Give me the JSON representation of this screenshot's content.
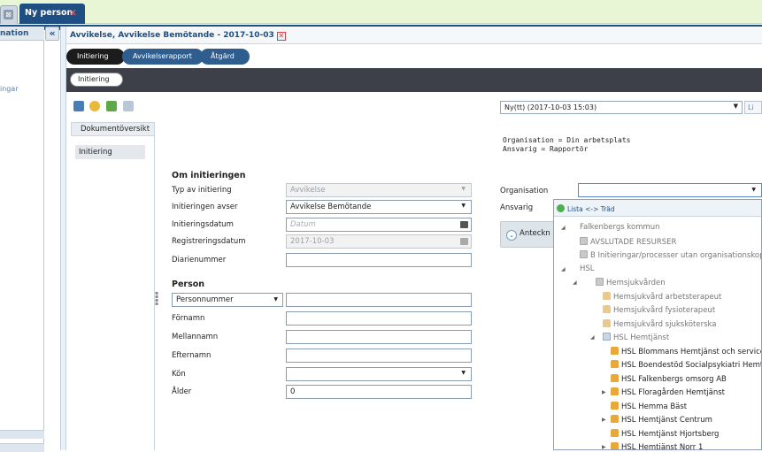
{
  "tabs": {
    "prev_close": "⊠",
    "active": "Ny person",
    "active_close": "✕"
  },
  "left_panel": {
    "header": "nation",
    "item": "ingar",
    "collapse": "«"
  },
  "document": {
    "title": "Avvikelse, Avvikelse Bemötande - 2017-10-03",
    "close": "✕"
  },
  "workflow": {
    "steps": [
      "Initiering",
      "Avvikelserapport",
      "Åtgärd"
    ],
    "sub": "Initiering"
  },
  "toolbar": {
    "ny_select": "Ny(tt)  (2017-10-03 15:03)",
    "list_btn": "Li"
  },
  "overview": {
    "header": "Dokumentöversikt",
    "item": "Initiering"
  },
  "org_info": "Organisation = Din arbetsplats\nAnsvarig = Rapportör",
  "om": {
    "title": "Om initieringen",
    "typ": {
      "label": "Typ av initiering",
      "value": "Avvikelse"
    },
    "avser": {
      "label": "Initieringen avser",
      "value": "Avvikelse Bemötande"
    },
    "datum": {
      "label": "Initieringsdatum",
      "placeholder": "Datum"
    },
    "reg": {
      "label": "Registreringsdatum",
      "value": "2017-10-03"
    },
    "diarie": {
      "label": "Diarienummer",
      "value": ""
    }
  },
  "person": {
    "title": "Person",
    "idtype": "Personnummer",
    "fornamn": "Förnamn",
    "mellannamn": "Mellannamn",
    "efternamn": "Efternamn",
    "kon": "Kön",
    "alder": {
      "label": "Ålder",
      "value": "0"
    }
  },
  "right": {
    "org_label": "Organisation",
    "ans_label": "Ansvarig",
    "anteckning": "Anteckn"
  },
  "tree": {
    "header": "Lista <-> Träd",
    "nodes": [
      {
        "text": "Falkenbergs kommun",
        "level": 0,
        "icon": "none",
        "expander": "open",
        "grey": true
      },
      {
        "text": "AVSLUTADE RESURSER",
        "level": 1,
        "icon": "grey",
        "expander": "none",
        "grey": true
      },
      {
        "text": "B Initieringar/processer utan organisationskoppling",
        "level": 1,
        "icon": "grey",
        "expander": "none",
        "grey": true
      },
      {
        "text": "HSL",
        "level": 1,
        "icon": "none",
        "expander": "open",
        "grey": true
      },
      {
        "text": "Hemsjukvården",
        "level": 2,
        "icon": "grey",
        "expander": "open",
        "grey": true
      },
      {
        "text": "Hemsjukvård arbetsterapeut",
        "level": 3,
        "icon": "homeg",
        "expander": "none",
        "grey": true
      },
      {
        "text": "Hemsjukvård fysioterapeut",
        "level": 3,
        "icon": "homeg",
        "expander": "none",
        "grey": true
      },
      {
        "text": "Hemsjukvård sjuksköterska",
        "level": 3,
        "icon": "homeg",
        "expander": "none",
        "grey": true
      },
      {
        "text": "HSL Hemtjänst",
        "level": 3,
        "icon": "blue",
        "expander": "open",
        "grey": true
      },
      {
        "text": "HSL Blommans Hemtjänst och service",
        "level": 4,
        "icon": "home",
        "expander": "none",
        "grey": false
      },
      {
        "text": "HSL Boendestöd Socialpsykiatri Hemtjänst",
        "level": 4,
        "icon": "home",
        "expander": "none",
        "grey": false
      },
      {
        "text": "HSL Falkenbergs omsorg AB",
        "level": 4,
        "icon": "home",
        "expander": "none",
        "grey": false
      },
      {
        "text": "HSL Floragården Hemtjänst",
        "level": 4,
        "icon": "home",
        "expander": "closed",
        "grey": false
      },
      {
        "text": "HSL Hemma Bäst",
        "level": 4,
        "icon": "home",
        "expander": "none",
        "grey": false
      },
      {
        "text": "HSL Hemtjänst Centrum",
        "level": 4,
        "icon": "home",
        "expander": "closed",
        "grey": false
      },
      {
        "text": "HSL Hemtjänst Hjortsberg",
        "level": 4,
        "icon": "home",
        "expander": "none",
        "grey": false
      },
      {
        "text": "HSL Hemtjänst Norr 1",
        "level": 4,
        "icon": "home",
        "expander": "closed",
        "grey": false
      }
    ]
  }
}
